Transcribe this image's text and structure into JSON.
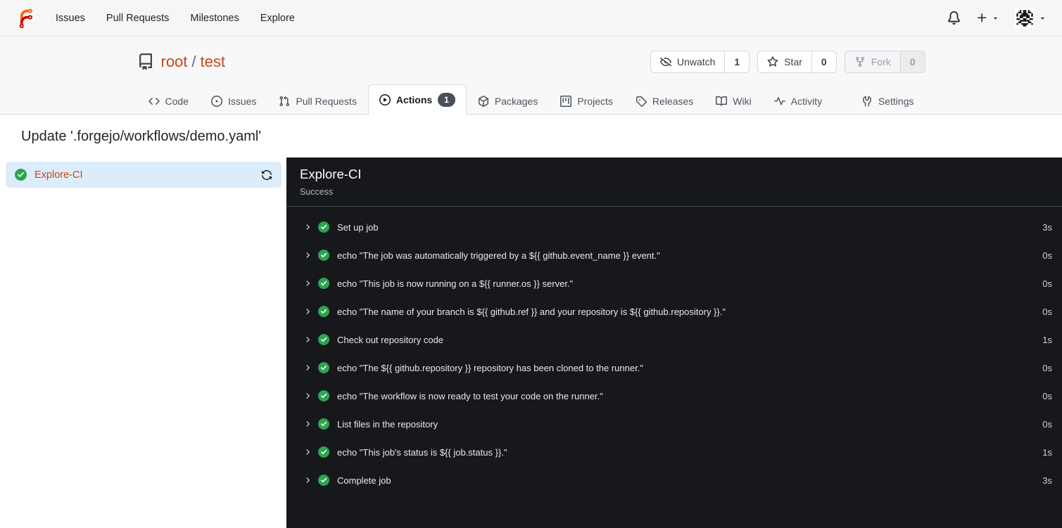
{
  "colors": {
    "accent": "#c8471d",
    "success": "#2da44e",
    "badge-bg": "#4a5058",
    "panel-bg": "#17181b"
  },
  "navbar": {
    "links": [
      {
        "label": "Issues"
      },
      {
        "label": "Pull Requests"
      },
      {
        "label": "Milestones"
      },
      {
        "label": "Explore"
      }
    ],
    "icons": [
      "bell-icon",
      "plus-icon",
      "avatar-identicon"
    ]
  },
  "repo": {
    "owner": "root",
    "separator": "/",
    "name": "test",
    "actions": [
      {
        "label": "Unwatch",
        "count": "1",
        "icon": "eye-closed-icon"
      },
      {
        "label": "Star",
        "count": "0",
        "icon": "star-icon"
      },
      {
        "label": "Fork",
        "count": "0",
        "icon": "fork-icon",
        "disabled": true
      }
    ],
    "tabs": [
      {
        "label": "Code",
        "icon": "code-icon"
      },
      {
        "label": "Issues",
        "icon": "issue-icon"
      },
      {
        "label": "Pull Requests",
        "icon": "pull-request-icon"
      },
      {
        "label": "Actions",
        "icon": "play-circle-icon",
        "active": true,
        "badge": "1"
      },
      {
        "label": "Packages",
        "icon": "package-icon"
      },
      {
        "label": "Projects",
        "icon": "project-icon"
      },
      {
        "label": "Releases",
        "icon": "tag-icon"
      },
      {
        "label": "Wiki",
        "icon": "book-icon"
      },
      {
        "label": "Activity",
        "icon": "pulse-icon"
      },
      {
        "label": "Settings",
        "icon": "tools-icon"
      }
    ]
  },
  "run": {
    "title": "Update '.forgejo/workflows/demo.yaml'",
    "job": {
      "name": "Explore-CI",
      "status": "Success"
    },
    "steps": [
      {
        "name": "Set up job",
        "duration": "3s"
      },
      {
        "name": "echo \"The job was automatically triggered by a ${{ github.event_name }} event.\"",
        "duration": "0s"
      },
      {
        "name": "echo \"This job is now running on a ${{ runner.os }} server.\"",
        "duration": "0s"
      },
      {
        "name": "echo \"The name of your branch is ${{ github.ref }} and your repository is ${{ github.repository }}.\"",
        "duration": "0s"
      },
      {
        "name": "Check out repository code",
        "duration": "1s"
      },
      {
        "name": "echo \"The ${{ github.repository }} repository has been cloned to the runner.\"",
        "duration": "0s"
      },
      {
        "name": "echo \"The workflow is now ready to test your code on the runner.\"",
        "duration": "0s"
      },
      {
        "name": "List files in the repository",
        "duration": "0s"
      },
      {
        "name": "echo \"This job's status is ${{ job.status }}.\"",
        "duration": "1s"
      },
      {
        "name": "Complete job",
        "duration": "3s"
      }
    ]
  }
}
